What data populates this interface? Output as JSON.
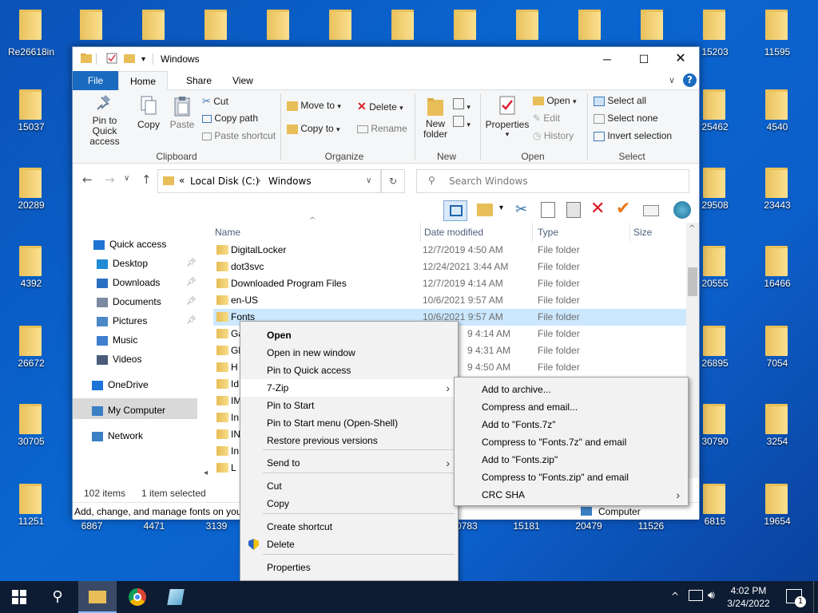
{
  "desktop": {
    "icons_top": [
      "Re26618in",
      "",
      "",
      "",
      "",
      "",
      "",
      "",
      "",
      "",
      "",
      "",
      "15203",
      "11595"
    ],
    "icons_right": [
      {
        "label": "15037"
      },
      {
        "label": "25462"
      },
      {
        "label": "4540"
      },
      {
        "label": "20289"
      },
      {
        "label": "29508"
      },
      {
        "label": "23443"
      },
      {
        "label": "4392"
      },
      {
        "label": "20555"
      },
      {
        "label": "16466"
      },
      {
        "label": "26672"
      },
      {
        "label": "26895"
      },
      {
        "label": "7054"
      },
      {
        "label": "30705"
      },
      {
        "label": "30790"
      },
      {
        "label": "3254"
      },
      {
        "label": "11251"
      },
      {
        "label": "6815"
      },
      {
        "label": "19654"
      }
    ],
    "bottom_labels": [
      "6867",
      "4471",
      "3139",
      "30783",
      "15181",
      "20479",
      "11526"
    ]
  },
  "window": {
    "title": "Windows",
    "tabs": {
      "file": "File",
      "home": "Home",
      "share": "Share",
      "view": "View"
    },
    "ribbon": {
      "pin_quick_access": "Pin to Quick access",
      "pin_line1": "Pin to Quick",
      "pin_line2": "access",
      "copy": "Copy",
      "paste": "Paste",
      "cut": "Cut",
      "copy_path": "Copy path",
      "paste_shortcut": "Paste shortcut",
      "group_clipboard": "Clipboard",
      "move_to": "Move to",
      "copy_to": "Copy to",
      "delete": "Delete",
      "rename": "Rename",
      "group_organize": "Organize",
      "new_folder_1": "New",
      "new_folder_2": "folder",
      "group_new": "New",
      "properties": "Properties",
      "open": "Open",
      "edit": "Edit",
      "history": "History",
      "group_open": "Open",
      "select_all": "Select all",
      "select_none": "Select none",
      "invert_selection": "Invert selection",
      "group_select": "Select"
    },
    "address": {
      "prefix": "«",
      "root": "Local Disk (C:)",
      "sep": "›",
      "current": "Windows"
    },
    "search_placeholder": "Search Windows",
    "nav_pane": [
      {
        "label": "Quick access",
        "color": "#1e73d2"
      },
      {
        "label": "Desktop",
        "color": "#1f8ad6",
        "pin": true
      },
      {
        "label": "Downloads",
        "color": "#2a6fc1",
        "pin": true
      },
      {
        "label": "Documents",
        "color": "#7a8aa0",
        "pin": true
      },
      {
        "label": "Pictures",
        "color": "#4a88c7",
        "pin": true
      },
      {
        "label": "Music",
        "color": "#3f7fd0"
      },
      {
        "label": "Videos",
        "color": "#4a5b7a"
      },
      {
        "label": "OneDrive",
        "color": "#1c73d8"
      },
      {
        "label": "My Computer",
        "color": "#3b7fc4"
      },
      {
        "label": "Network",
        "color": "#3b7fc4"
      }
    ],
    "columns": {
      "name": "Name",
      "date": "Date modified",
      "type": "Type",
      "size": "Size"
    },
    "files": [
      {
        "name": "DigitalLocker",
        "date": "12/7/2019 4:50 AM",
        "type": "File folder"
      },
      {
        "name": "dot3svc",
        "date": "12/24/2021 3:44 AM",
        "type": "File folder"
      },
      {
        "name": "Downloaded Program Files",
        "date": "12/7/2019 4:14 AM",
        "type": "File folder"
      },
      {
        "name": "en-US",
        "date": "10/6/2021 9:57 AM",
        "type": "File folder"
      },
      {
        "name": "Fonts",
        "date": "10/6/2021 9:57 AM",
        "type": "File folder"
      },
      {
        "name": "Ga",
        "date": "9 4:14 AM",
        "type": "File folder"
      },
      {
        "name": "Gl",
        "date": "9 4:31 AM",
        "type": "File folder"
      },
      {
        "name": "H",
        "date": "9 4:50 AM",
        "type": "File folder"
      },
      {
        "name": "Id",
        "date": "",
        "type": ""
      },
      {
        "name": "IM",
        "date": "",
        "type": ""
      },
      {
        "name": "In",
        "date": "",
        "type": ""
      },
      {
        "name": "IN",
        "date": "",
        "type": ""
      },
      {
        "name": "In",
        "date": "",
        "type": ""
      },
      {
        "name": "L",
        "date": "",
        "type": ""
      }
    ],
    "status": {
      "count": "102 items",
      "selected": "1 item selected"
    },
    "tip": "Add, change, and manage fonts on you",
    "tip_right": "Computer"
  },
  "context_menu": {
    "items": [
      {
        "label": "Open",
        "bold": true
      },
      {
        "label": "Open in new window"
      },
      {
        "label": "Pin to Quick access"
      },
      {
        "label": "7-Zip",
        "submenu": true
      },
      {
        "label": "Pin to Start"
      },
      {
        "label": "Pin to Start menu (Open-Shell)"
      },
      {
        "label": "Restore previous versions"
      },
      {
        "label": "Send to",
        "submenu": true
      },
      {
        "label": "Cut"
      },
      {
        "label": "Copy"
      },
      {
        "label": "Create shortcut"
      },
      {
        "label": "Delete"
      },
      {
        "label": "Properties"
      }
    ]
  },
  "submenu_7zip": {
    "items": [
      {
        "label": "Add to archive..."
      },
      {
        "label": "Compress and email..."
      },
      {
        "label": "Add to \"Fonts.7z\""
      },
      {
        "label": "Compress to \"Fonts.7z\" and email"
      },
      {
        "label": "Add to \"Fonts.zip\""
      },
      {
        "label": "Compress to \"Fonts.zip\" and email"
      },
      {
        "label": "CRC SHA",
        "submenu": true
      }
    ]
  },
  "taskbar": {
    "time": "4:02 PM",
    "date": "3/24/2022",
    "notification_count": "1"
  }
}
